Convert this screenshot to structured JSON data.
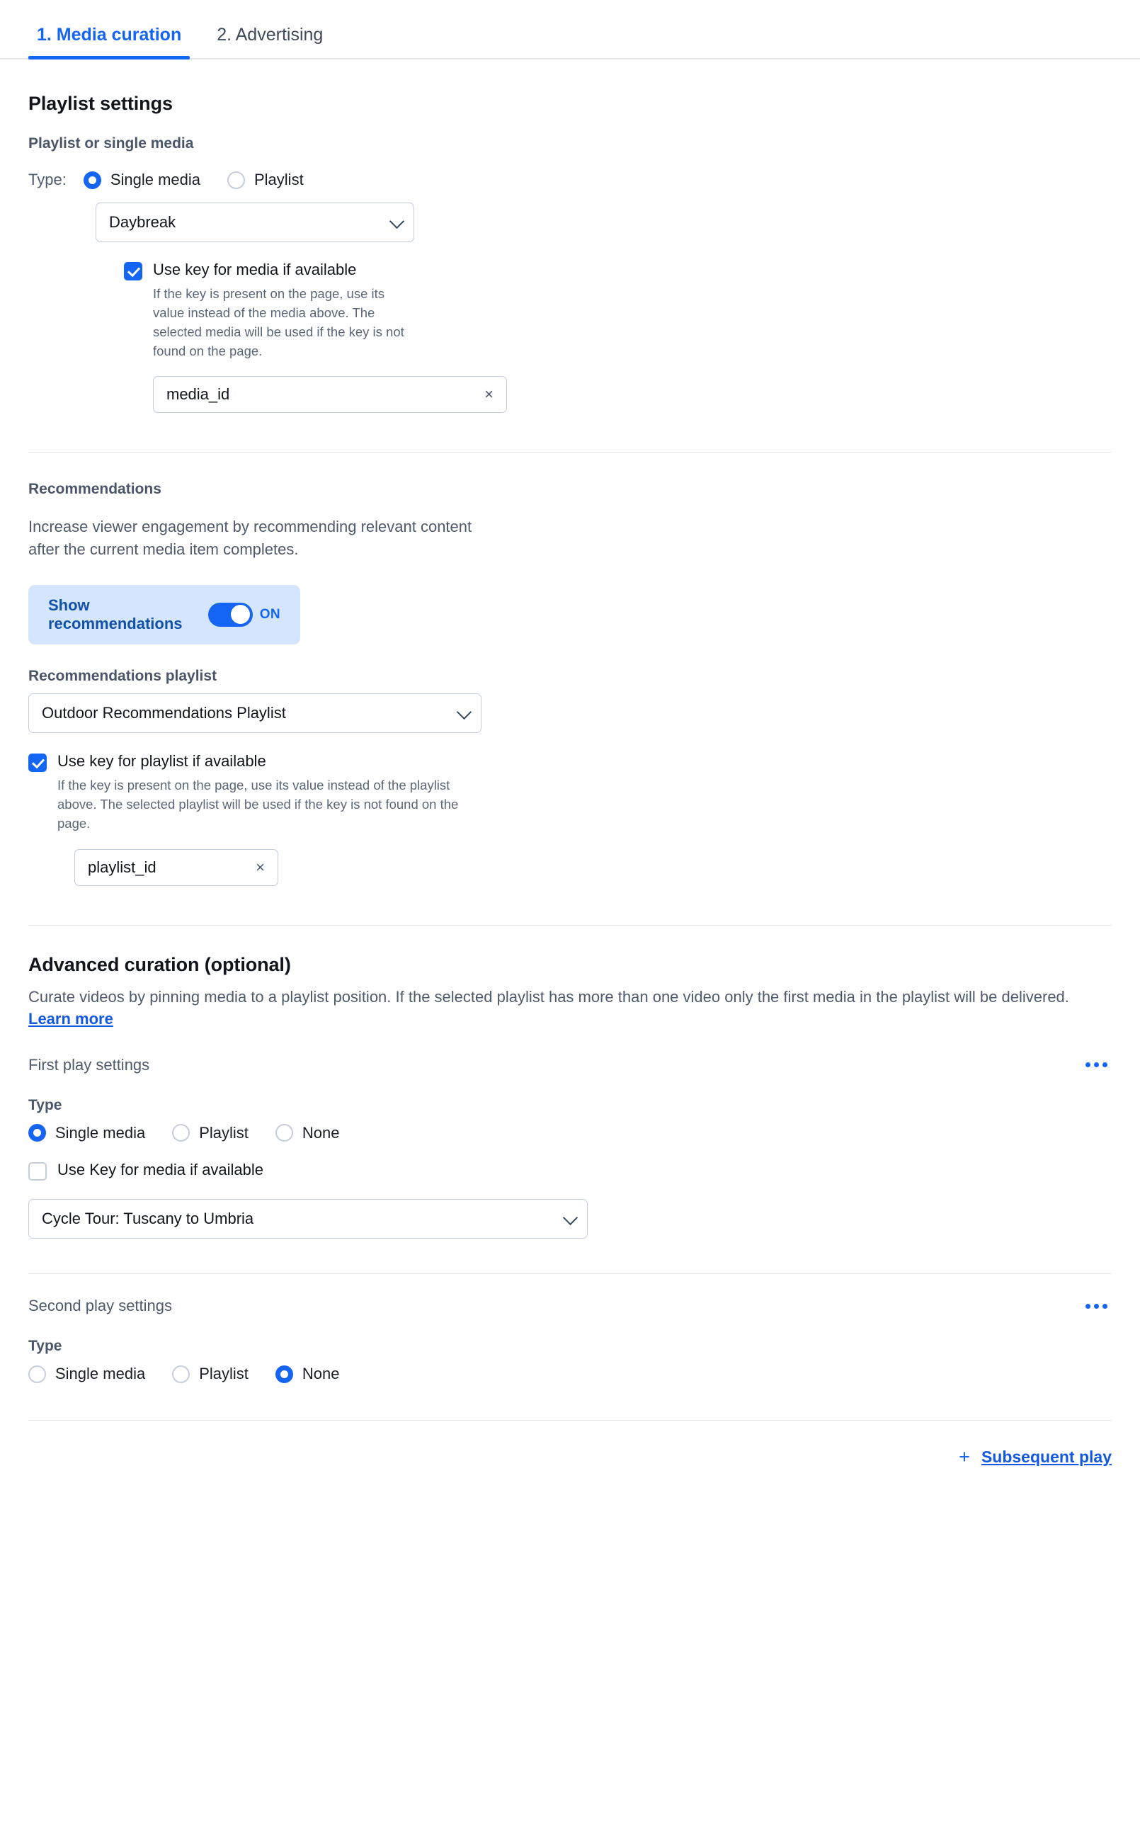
{
  "tabs": [
    {
      "label": "1. Media curation",
      "active": true
    },
    {
      "label": "2. Advertising",
      "active": false
    }
  ],
  "playlist_settings": {
    "heading": "Playlist settings",
    "sub_label": "Playlist or single media",
    "type_lead": "Type:",
    "type_options": [
      "Single media",
      "Playlist"
    ],
    "type_selected": "Single media",
    "media_select_value": "Daybreak",
    "use_key_checkbox_label": "Use key for media if available",
    "use_key_checked": true,
    "use_key_help": "If the key is present on the page, use its value instead of the media above. The selected media will be used if the key is not found on the page.",
    "key_value": "media_id",
    "clear_icon": "×"
  },
  "recommendations": {
    "heading": "Recommendations",
    "description": "Increase viewer engagement by recommending relevant content after the current media item completes.",
    "toggle_label": "Show recommendations",
    "toggle_state": "ON",
    "playlist_label": "Recommendations playlist",
    "playlist_value": "Outdoor Recommendations Playlist",
    "use_key_checkbox_label": "Use key for playlist if available",
    "use_key_checked": true,
    "use_key_help": "If the key is present on the page, use its value instead of the playlist above. The selected playlist will be used if the key is not found on the page.",
    "key_value": "playlist_id",
    "clear_icon": "×"
  },
  "advanced_curation": {
    "heading": "Advanced curation (optional)",
    "description": "Curate videos by pinning media to a playlist position. If the selected playlist has more than one video only the first media in the playlist will be delivered.",
    "learn_more": "Learn more",
    "first_play": {
      "title": "First play settings",
      "menu_icon": "ellipsis-icon",
      "type_label": "Type",
      "type_options": [
        "Single media",
        "Playlist",
        "None"
      ],
      "type_selected": "Single media",
      "use_key_checkbox_label": "Use Key for media if available",
      "use_key_checked": false,
      "media_select_value": "Cycle Tour: Tuscany to Umbria"
    },
    "second_play": {
      "title": "Second play settings",
      "menu_icon": "ellipsis-icon",
      "type_label": "Type",
      "type_options": [
        "Single media",
        "Playlist",
        "None"
      ],
      "type_selected": "None"
    }
  },
  "footer": {
    "add_icon": "+",
    "add_label": "Subsequent play"
  },
  "colors": {
    "accent": "#1565f5",
    "link": "#1358e0",
    "banner_bg": "#d3e6fd",
    "muted_text": "#4f5a6b",
    "border": "#c3cddd"
  }
}
